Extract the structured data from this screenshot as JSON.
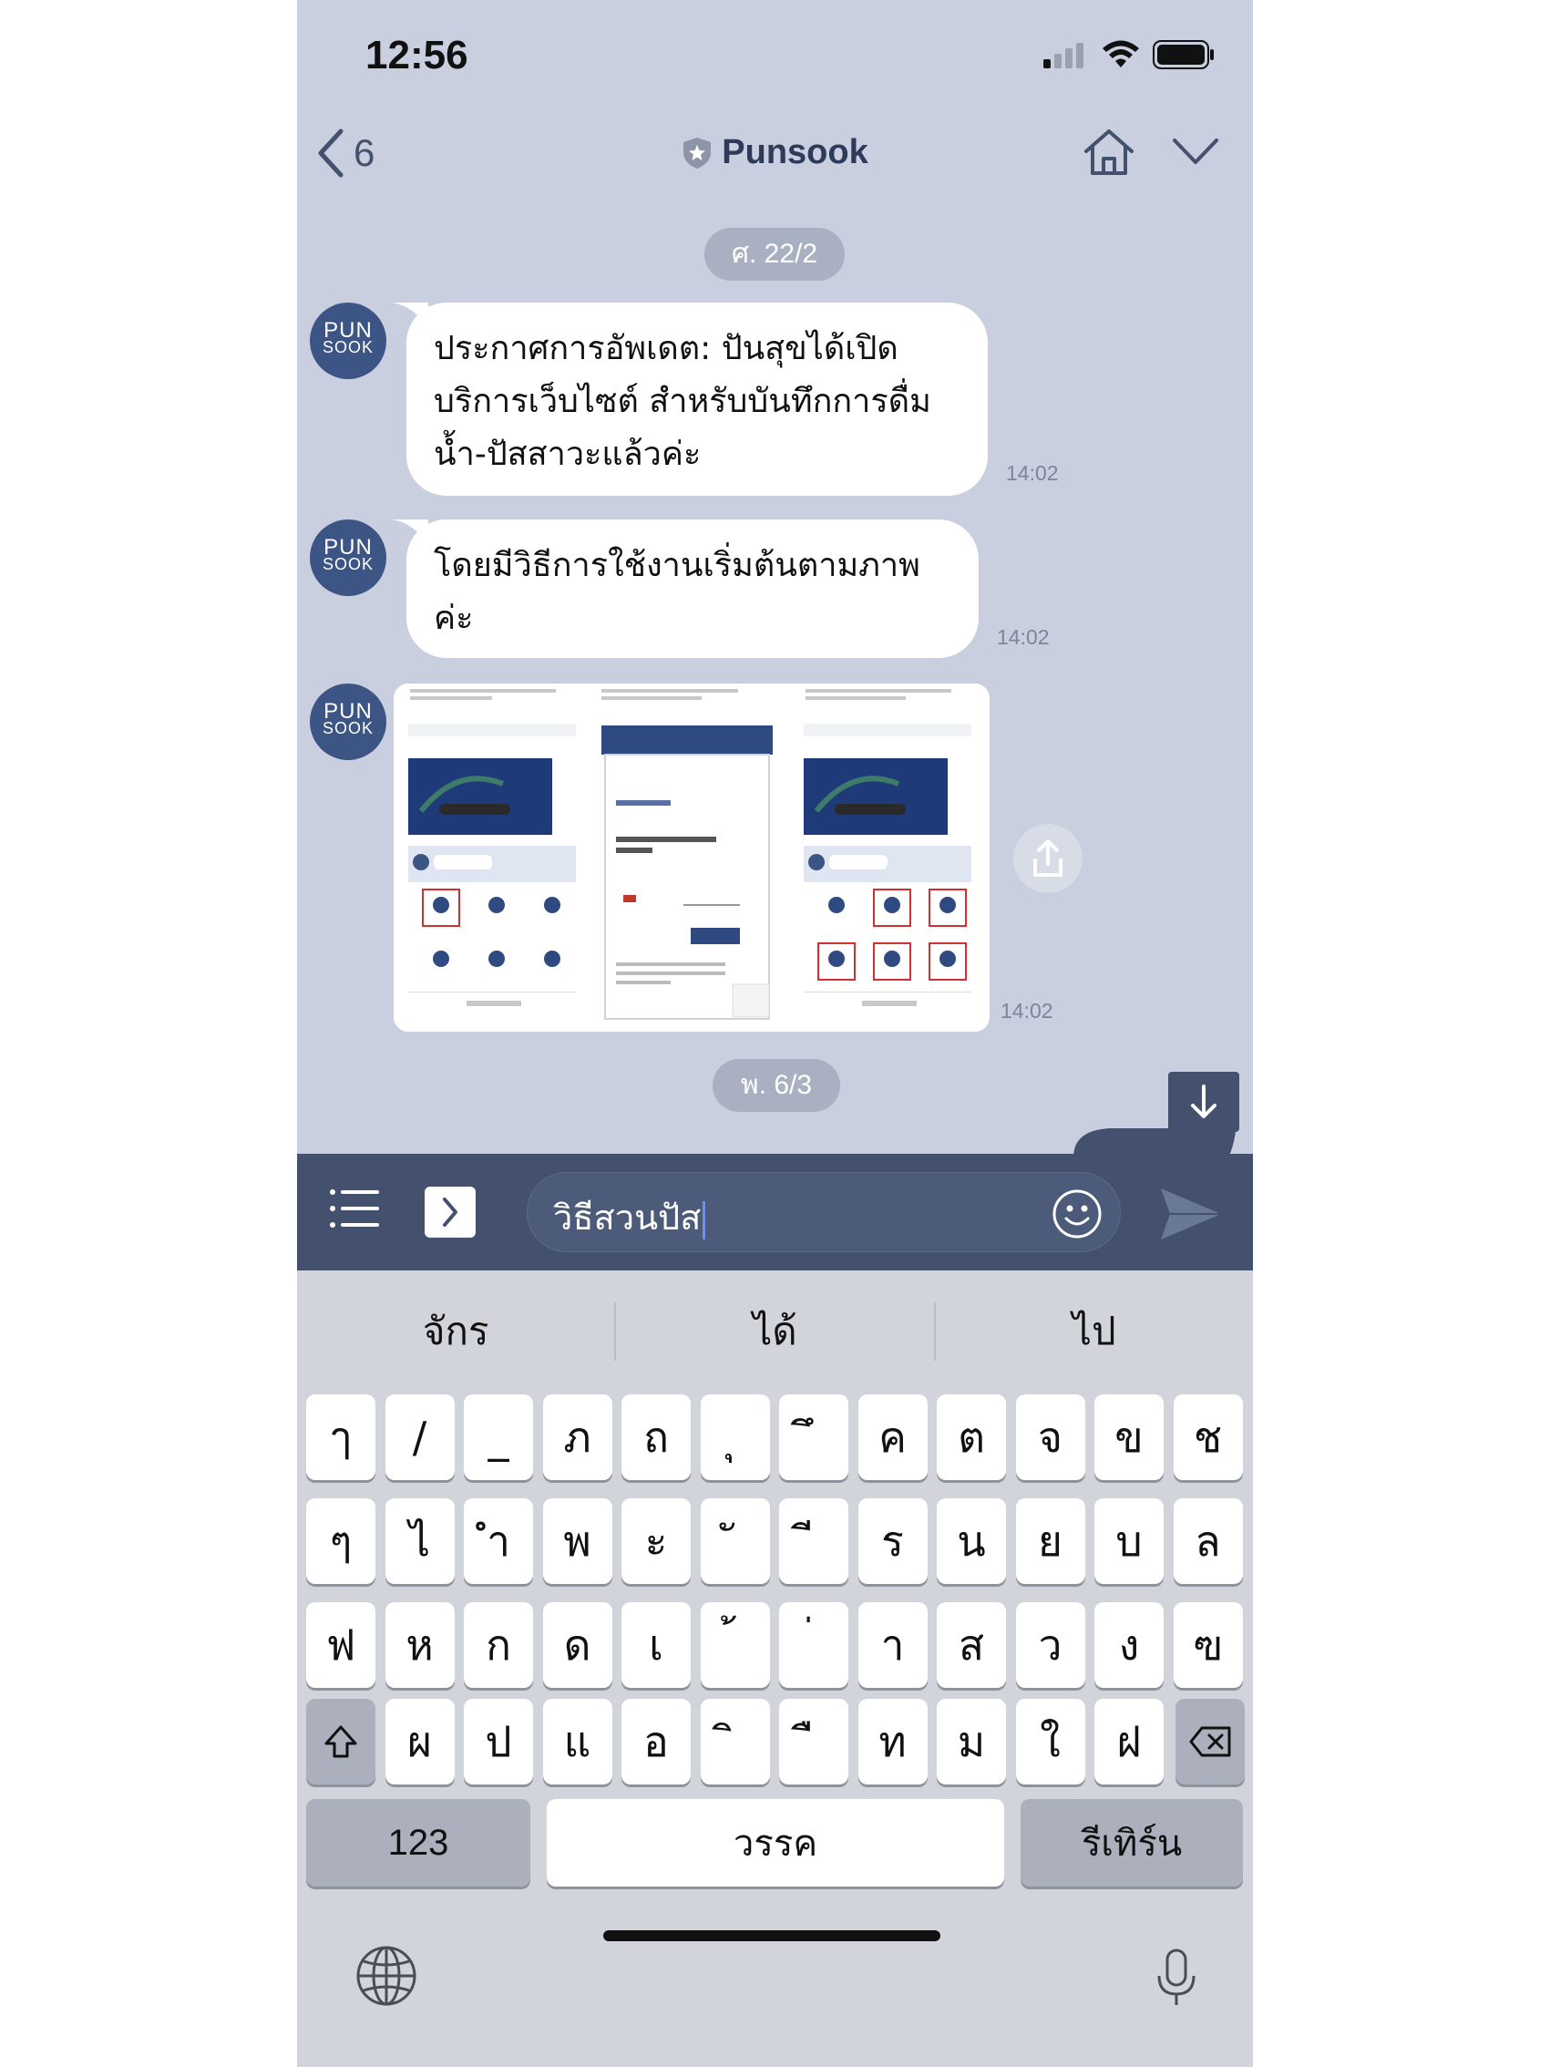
{
  "status_bar": {
    "time": "12:56"
  },
  "header": {
    "back_count": "6",
    "title": "Punsook",
    "icons": [
      "chevron-left-icon",
      "verified-shield-icon",
      "home-icon",
      "chevron-down-icon"
    ]
  },
  "avatar": {
    "line1": "PUN",
    "line2": "SOOK"
  },
  "messages": [
    {
      "date": "ศ. 22/2"
    },
    {
      "text_lines": [
        "ประกาศการอัพเดต: ปันสุขได้เปิด",
        "บริการเว็บไซต์ สำหรับบันทึกการดื่ม",
        "น้ำ-ปัสสาวะแล้วค่ะ"
      ],
      "time": "14:02"
    },
    {
      "text_lines": [
        "โดยมีวิธีการใช้งานเริ่มต้นตามภาพ",
        "ค่ะ"
      ],
      "time": "14:02"
    },
    {
      "type": "image",
      "time": "14:02"
    },
    {
      "date": "พ. 6/3"
    }
  ],
  "input": {
    "value": "วิธีสวนปัส"
  },
  "keyboard": {
    "suggestions": [
      "จักร",
      "ได้",
      "ไป"
    ],
    "row1": [
      "ๅ",
      "/",
      "_",
      "ภ",
      "ถ",
      "ุ",
      "ึ",
      "ค",
      "ต",
      "จ",
      "ข",
      "ช"
    ],
    "row2": [
      "ๆ",
      "ไ",
      "ำ",
      "พ",
      "ะ",
      "ั",
      "ี",
      "ร",
      "น",
      "ย",
      "บ",
      "ล"
    ],
    "row3": [
      "ฟ",
      "ห",
      "ก",
      "ด",
      "เ",
      "้",
      "่",
      "า",
      "ส",
      "ว",
      "ง",
      "ฃ"
    ],
    "row4": [
      "ผ",
      "ป",
      "แ",
      "อ",
      "ิ",
      "ื",
      "ท",
      "ม",
      "ใ",
      "ฝ"
    ],
    "numbers_label": "123",
    "space_label": "วรรค",
    "return_label": "รีเทิร์น"
  },
  "colors": {
    "chat_bg": "#c9cfde",
    "bar_navy": "#43516f",
    "avatar_navy": "#3c5584",
    "keyboard_bg": "#d1d4db"
  }
}
